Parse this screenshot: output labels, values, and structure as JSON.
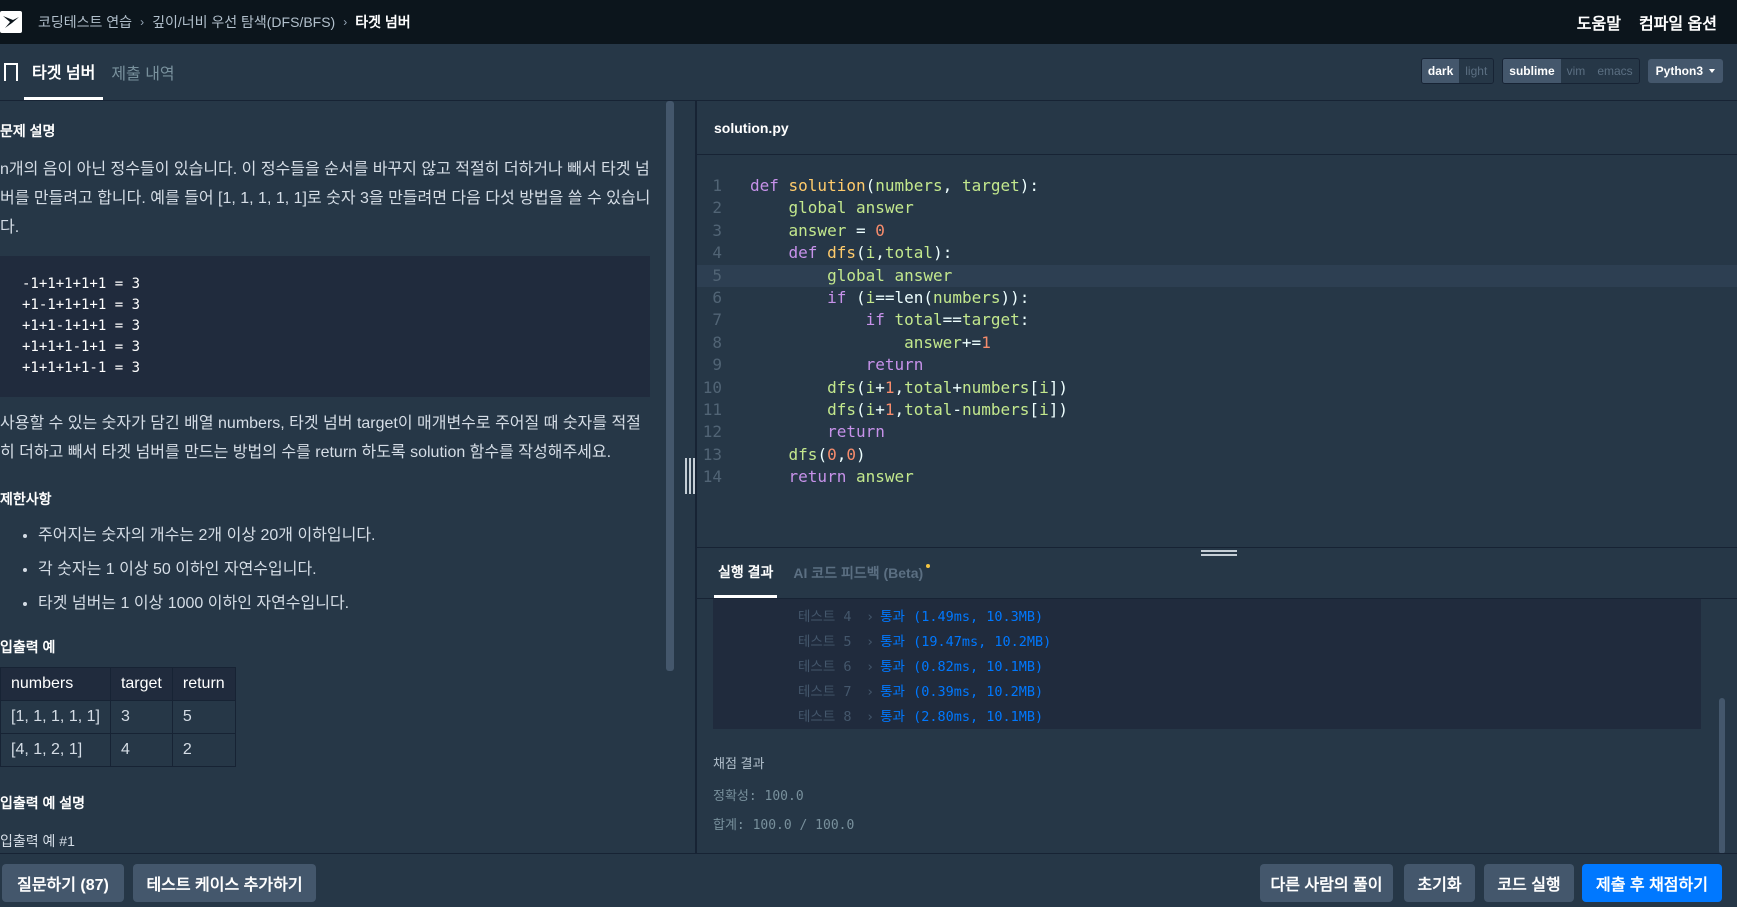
{
  "header": {
    "breadcrumb": [
      "코딩테스트 연습",
      "깊이/너비 우선 탐색(DFS/BFS)",
      "타겟 넘버"
    ],
    "help": "도움말",
    "compile_options": "컴파일 옵션"
  },
  "tabs": {
    "problem": "타겟 넘버",
    "submissions": "제출 내역"
  },
  "editor_settings": {
    "theme": [
      "dark",
      "light"
    ],
    "keymap": [
      "sublime",
      "vim",
      "emacs"
    ],
    "language": "Python3"
  },
  "problem": {
    "desc_title": "문제 설명",
    "desc_line1": "n개의 음이 아닌 정수들이 있습니다. 이 정수들을 순서를 바꾸지 않고 적절히 더하거나 빼서 타겟 넘",
    "desc_line2": "버를 만들려고 합니다. 예를 들어 [1, 1, 1, 1, 1]로 숫자 3을 만들려면 다음 다섯 방법을 쓸 수 있습니",
    "desc_line3": "다.",
    "examples_code": [
      "-1+1+1+1+1 = 3",
      "+1-1+1+1+1 = 3",
      "+1+1-1+1+1 = 3",
      "+1+1+1-1+1 = 3",
      "+1+1+1+1-1 = 3"
    ],
    "task_line1": "사용할 수 있는 숫자가 담긴 배열 numbers, 타겟 넘버 target이 매개변수로 주어질 때 숫자를 적절",
    "task_line2": "히 더하고 빼서 타겟 넘버를 만드는 방법의 수를 return 하도록 solution 함수를 작성해주세요.",
    "constraints_title": "제한사항",
    "constraints": [
      "주어지는 숫자의 개수는 2개 이상 20개 이하입니다.",
      "각 숫자는 1 이상 50 이하인 자연수입니다.",
      "타겟 넘버는 1 이상 1000 이하인 자연수입니다."
    ],
    "io_title": "입출력 예",
    "io_headers": [
      "numbers",
      "target",
      "return"
    ],
    "io_rows": [
      [
        "[1, 1, 1, 1, 1]",
        "3",
        "5"
      ],
      [
        "[4, 1, 2, 1]",
        "4",
        "2"
      ]
    ],
    "io_desc_title": "입출력 예 설명",
    "io_desc_sub": "입출력 예 #1"
  },
  "editor": {
    "filename": "solution.py",
    "line_numbers": [
      "1",
      "2",
      "3",
      "4",
      "5",
      "6",
      "7",
      "8",
      "9",
      "10",
      "11",
      "12",
      "13",
      "14"
    ]
  },
  "result": {
    "tab_run": "실행 결과",
    "tab_ai": "AI 코드 피드백 (Beta)",
    "cases": [
      {
        "label": "테스트 4",
        "result": "통과 (1.49ms, 10.3MB)"
      },
      {
        "label": "테스트 5",
        "result": "통과 (19.47ms, 10.2MB)"
      },
      {
        "label": "테스트 6",
        "result": "통과 (0.82ms, 10.1MB)"
      },
      {
        "label": "테스트 7",
        "result": "통과 (0.39ms, 10.2MB)"
      },
      {
        "label": "테스트 8",
        "result": "통과 (2.80ms, 10.1MB)"
      }
    ],
    "score_title": "채점 결과",
    "accuracy": "정확성: 100.0",
    "total": "합계: 100.0 / 100.0"
  },
  "bottom": {
    "ask": "질문하기 (87)",
    "add_testcase": "테스트 케이스 추가하기",
    "others": "다른 사람의 풀이",
    "reset": "초기화",
    "run": "코드 실행",
    "submit": "제출 후 채점하기"
  }
}
